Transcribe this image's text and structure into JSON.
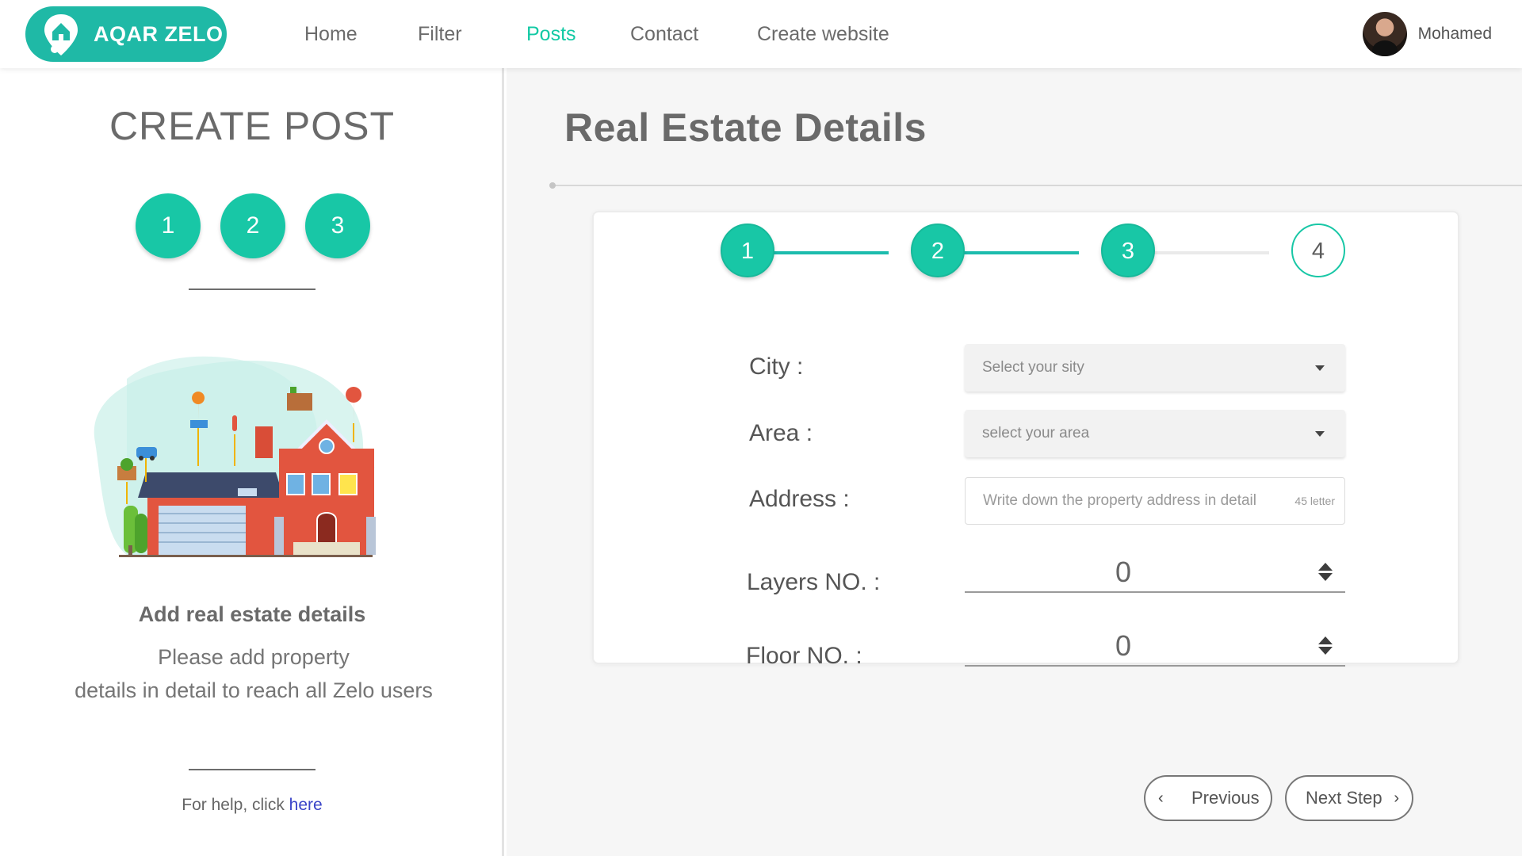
{
  "brand": {
    "name": "AQAR ZELO",
    "color": "#1fb9a6"
  },
  "nav": {
    "items": [
      {
        "label": "Home"
      },
      {
        "label": "Filter"
      },
      {
        "label": "Posts",
        "active": true
      },
      {
        "label": "Contact"
      },
      {
        "label": "Create website"
      }
    ]
  },
  "user": {
    "name": "Mohamed"
  },
  "sidebar": {
    "title": "CREATE POST",
    "steps": [
      "1",
      "2",
      "3"
    ],
    "heading": "Add real estate details",
    "description_line1": "Please add property",
    "description_line2": "details in detail to reach all Zelo users",
    "help_text": "For help, click",
    "help_link": "here"
  },
  "main": {
    "title": "Real Estate Details",
    "progress": {
      "steps": [
        "1",
        "2",
        "3",
        "4"
      ],
      "completed": 3,
      "accent": "#18c7a6"
    },
    "form": {
      "city": {
        "label": "City :",
        "placeholder": "Select your sity"
      },
      "area": {
        "label": "Area :",
        "placeholder": "select your area"
      },
      "address": {
        "label": "Address :",
        "placeholder": "Write down the property address in detail",
        "counter": "45 letter"
      },
      "layers": {
        "label": "Layers NO. :",
        "value": "0"
      },
      "floor": {
        "label": "Floor NO. :",
        "value": "0"
      }
    },
    "buttons": {
      "previous": "Previous",
      "next": "Next Step",
      "previous_icon": "‹",
      "next_icon": "›"
    }
  }
}
